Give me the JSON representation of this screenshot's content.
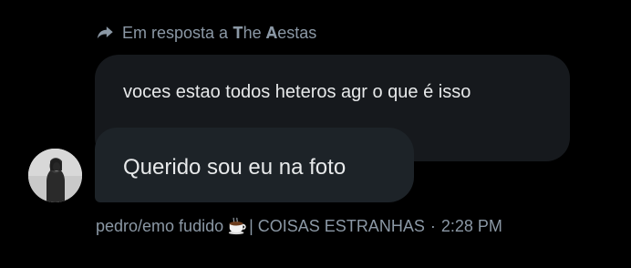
{
  "reply": {
    "prefix": "Em resposta a",
    "name": "𝐓he 𝐀estas"
  },
  "messages": [
    {
      "text": "voces estao todos heteros agr o que é isso"
    },
    {
      "text": "Querido sou eu na foto"
    }
  ],
  "sender": {
    "name_before_icon": "pedro/emo fudido",
    "icon": "coffee-cup-icon",
    "name_after_icon": "| COISAS ESTRANHAS",
    "separator": "·",
    "time": "2:28 PM"
  },
  "colors": {
    "background": "#000000",
    "bubble": "#16191d",
    "bubble_front": "#1d2328",
    "text": "#e7e9ea",
    "muted": "#8b98a5"
  }
}
